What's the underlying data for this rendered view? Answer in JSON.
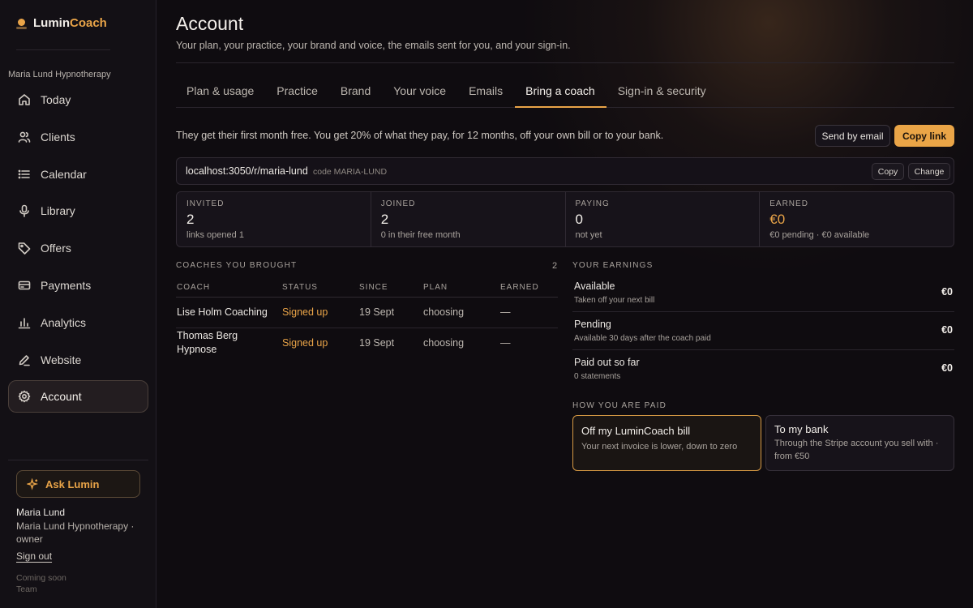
{
  "brand": {
    "name_a": "Lumin",
    "name_b": "Coach",
    "accent": "#e9a448"
  },
  "sidebar": {
    "practice": "Maria Lund Hypnotherapy",
    "items": [
      {
        "label": "Today",
        "icon": "home-icon"
      },
      {
        "label": "Clients",
        "icon": "users-icon"
      },
      {
        "label": "Calendar",
        "icon": "list-icon"
      },
      {
        "label": "Library",
        "icon": "mic-icon"
      },
      {
        "label": "Offers",
        "icon": "tag-icon"
      },
      {
        "label": "Payments",
        "icon": "card-icon"
      },
      {
        "label": "Analytics",
        "icon": "chart-icon"
      },
      {
        "label": "Website",
        "icon": "edit-icon"
      },
      {
        "label": "Account",
        "icon": "gear-icon",
        "active": true
      }
    ],
    "ask": "Ask Lumin",
    "user_name": "Maria Lund",
    "user_role": "Maria Lund Hypnotherapy · owner",
    "sign_out": "Sign out",
    "coming_soon": "Coming soon",
    "team": "Team"
  },
  "page": {
    "title": "Account",
    "subtitle": "Your plan, your practice, your brand and voice, the emails sent for you, and your sign-in."
  },
  "tabs": [
    {
      "label": "Plan & usage"
    },
    {
      "label": "Practice"
    },
    {
      "label": "Brand"
    },
    {
      "label": "Your voice"
    },
    {
      "label": "Emails"
    },
    {
      "label": "Bring a coach",
      "active": true
    },
    {
      "label": "Sign-in & security"
    }
  ],
  "referral": {
    "intro": "They get their first month free. You get 20% of what they pay, for 12 months, off your own bill or to your bank.",
    "send_email": "Send by email",
    "copy_link": "Copy link",
    "url": "localhost:3050/r/maria-lund",
    "code": "code MARIA-LUND",
    "copy": "Copy",
    "change": "Change"
  },
  "stats": [
    {
      "label": "INVITED",
      "value": "2",
      "note": "links opened 1"
    },
    {
      "label": "JOINED",
      "value": "2",
      "note": "0 in their free month"
    },
    {
      "label": "PAYING",
      "value": "0",
      "note": "not yet"
    },
    {
      "label": "EARNED",
      "value": "€0",
      "note": "€0 pending · €0 available"
    }
  ],
  "coaches": {
    "heading": "COACHES YOU BROUGHT",
    "count": "2",
    "columns": [
      "COACH",
      "STATUS",
      "SINCE",
      "PLAN",
      "EARNED"
    ],
    "rows": [
      {
        "coach": "Lise Holm Coaching",
        "status": "Signed up",
        "since": "19 Sept",
        "plan": "choosing",
        "earned": "—"
      },
      {
        "coach": "Thomas Berg Hypnose",
        "status": "Signed up",
        "since": "19 Sept",
        "plan": "choosing",
        "earned": "—"
      }
    ]
  },
  "earnings": {
    "heading": "YOUR EARNINGS",
    "rows": [
      {
        "title": "Available",
        "note": "Taken off your next bill",
        "value": "€0"
      },
      {
        "title": "Pending",
        "note": "Available 30 days after the coach paid",
        "value": "€0"
      },
      {
        "title": "Paid out so far",
        "note": "0 statements",
        "value": "€0"
      }
    ]
  },
  "payout": {
    "heading": "HOW YOU ARE PAID",
    "options": [
      {
        "title": "Off my LuminCoach bill",
        "desc": "Your next invoice is lower, down to zero",
        "selected": true
      },
      {
        "title": "To my bank",
        "desc": "Through the Stripe account you sell with · from €50"
      }
    ]
  }
}
